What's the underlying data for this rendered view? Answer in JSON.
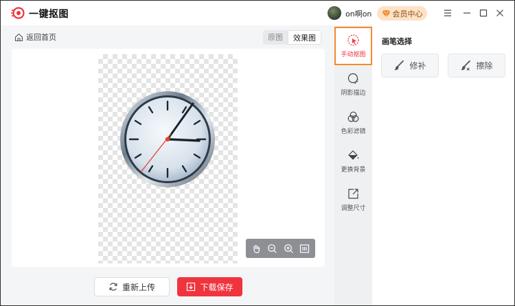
{
  "app": {
    "title": "一键抠图"
  },
  "user": {
    "name": "on啊on"
  },
  "vip": {
    "label": "会员中心"
  },
  "nav": {
    "back_label": "返回首页"
  },
  "view_tabs": [
    {
      "label": "原图",
      "active": false
    },
    {
      "label": "效果图",
      "active": true
    }
  ],
  "actions": {
    "reupload_label": "重新上传",
    "download_label": "下载保存"
  },
  "tools": [
    {
      "label": "手动抠图",
      "icon": "cursor-click-icon",
      "active": true
    },
    {
      "label": "阴影描边",
      "icon": "shadow-outline-icon",
      "active": false
    },
    {
      "label": "色彩滤镜",
      "icon": "color-filter-icon",
      "active": false
    },
    {
      "label": "更换背景",
      "icon": "paint-bucket-icon",
      "active": false
    },
    {
      "label": "调整尺寸",
      "icon": "resize-icon",
      "active": false
    }
  ],
  "panel": {
    "title": "画笔选择",
    "brushes": [
      {
        "label": "修补",
        "icon": "brush-icon"
      },
      {
        "label": "擦除",
        "icon": "eraser-icon"
      }
    ]
  },
  "colors": {
    "accent": "#f0333d",
    "highlight": "#f28a28",
    "vip_bg": "#fde2c6"
  }
}
